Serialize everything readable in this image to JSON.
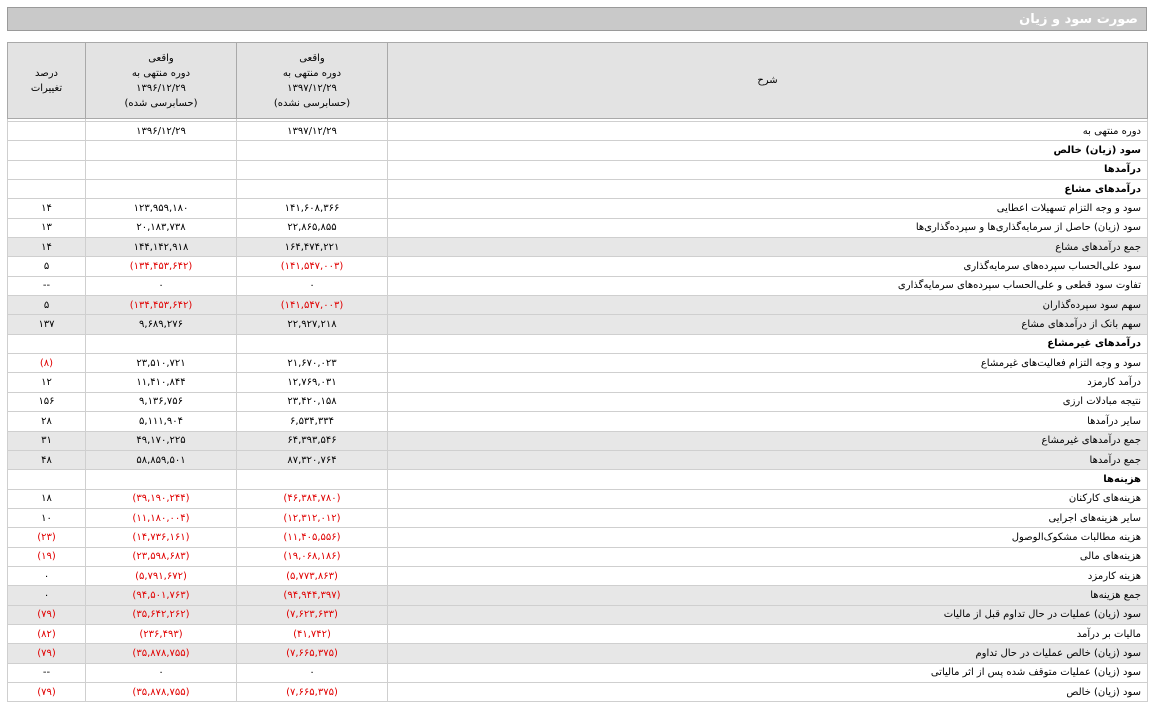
{
  "title": "صورت سود و زیان",
  "header": {
    "description": "شرح",
    "current": [
      "واقعی",
      "دوره منتهی به",
      "۱۳۹۷/۱۲/۲۹",
      "(حسابرسی نشده)"
    ],
    "previous": [
      "واقعی",
      "دوره منتهی به",
      "۱۳۹۶/۱۲/۲۹",
      "(حسابرسی شده)"
    ],
    "change": [
      "درصد",
      "تغییرات"
    ]
  },
  "rows": [
    {
      "desc": "دوره منتهی به",
      "cur": "۱۳۹۷/۱۲/۲۹",
      "prev": "۱۳۹۶/۱۲/۲۹",
      "pct": "",
      "bold": false,
      "shade": false
    },
    {
      "desc": "سود (زیان) خالص",
      "cur": "",
      "prev": "",
      "pct": "",
      "bold": true,
      "shade": false
    },
    {
      "desc": "درآمدها",
      "cur": "",
      "prev": "",
      "pct": "",
      "bold": true,
      "shade": false
    },
    {
      "desc": "درآمدهای مشاع",
      "cur": "",
      "prev": "",
      "pct": "",
      "bold": true,
      "shade": false
    },
    {
      "desc": "سود و وجه التزام تسهیلات اعطایی",
      "cur": "۱۴۱,۶۰۸,۳۶۶",
      "prev": "۱۲۳,۹۵۹,۱۸۰",
      "pct": "۱۴",
      "bold": false,
      "shade": false
    },
    {
      "desc": "سود (زیان) حاصل از سرمایه‌گذاری‌ها و سپرده‌گذاری‌ها",
      "cur": "۲۲,۸۶۵,۸۵۵",
      "prev": "۲۰,۱۸۳,۷۳۸",
      "pct": "۱۳",
      "bold": false,
      "shade": false
    },
    {
      "desc": "جمع درآمدهای مشاع",
      "cur": "۱۶۴,۴۷۴,۲۲۱",
      "prev": "۱۴۴,۱۴۲,۹۱۸",
      "pct": "۱۴",
      "bold": false,
      "shade": true
    },
    {
      "desc": "سود علی‌الحساب سپرده‌های سرمایه‌گذاری",
      "cur": "(۱۴۱,۵۴۷,۰۰۳)",
      "prev": "(۱۳۴,۴۵۳,۶۴۲)",
      "pct": "۵",
      "bold": false,
      "shade": false
    },
    {
      "desc": "تفاوت سود قطعی و علی‌الحساب سپرده‌های سرمایه‌گذاری",
      "cur": "۰",
      "prev": "۰",
      "pct": "--",
      "bold": false,
      "shade": false
    },
    {
      "desc": "سهم سود سپرده‌گذاران",
      "cur": "(۱۴۱,۵۴۷,۰۰۳)",
      "prev": "(۱۳۴,۴۵۳,۶۴۲)",
      "pct": "۵",
      "bold": false,
      "shade": true
    },
    {
      "desc": "سهم بانک از درآمدهای مشاع",
      "cur": "۲۲,۹۲۷,۲۱۸",
      "prev": "۹,۶۸۹,۲۷۶",
      "pct": "۱۳۷",
      "bold": false,
      "shade": true
    },
    {
      "desc": "درآمدهای غیرمشاع",
      "cur": "",
      "prev": "",
      "pct": "",
      "bold": true,
      "shade": false
    },
    {
      "desc": "سود و وجه التزام فعالیت‌های غیرمشاع",
      "cur": "۲۱,۶۷۰,۰۲۳",
      "prev": "۲۳,۵۱۰,۷۲۱",
      "pct": "(۸)",
      "bold": false,
      "shade": false
    },
    {
      "desc": "درآمد کارمزد",
      "cur": "۱۲,۷۶۹,۰۳۱",
      "prev": "۱۱,۴۱۰,۸۴۴",
      "pct": "۱۲",
      "bold": false,
      "shade": false
    },
    {
      "desc": "نتیجه مبادلات ارزی",
      "cur": "۲۳,۴۲۰,۱۵۸",
      "prev": "۹,۱۳۶,۷۵۶",
      "pct": "۱۵۶",
      "bold": false,
      "shade": false
    },
    {
      "desc": "سایر درآمدها",
      "cur": "۶,۵۳۴,۳۳۴",
      "prev": "۵,۱۱۱,۹۰۴",
      "pct": "۲۸",
      "bold": false,
      "shade": false
    },
    {
      "desc": "جمع درآمدهای غیرمشاع",
      "cur": "۶۴,۳۹۳,۵۴۶",
      "prev": "۴۹,۱۷۰,۲۲۵",
      "pct": "۳۱",
      "bold": false,
      "shade": true
    },
    {
      "desc": "جمع درآمدها",
      "cur": "۸۷,۳۲۰,۷۶۴",
      "prev": "۵۸,۸۵۹,۵۰۱",
      "pct": "۴۸",
      "bold": false,
      "shade": true
    },
    {
      "desc": "هزینه‌ها",
      "cur": "",
      "prev": "",
      "pct": "",
      "bold": true,
      "shade": false
    },
    {
      "desc": "هزینه‌های کارکنان",
      "cur": "(۴۶,۳۸۴,۷۸۰)",
      "prev": "(۳۹,۱۹۰,۲۴۴)",
      "pct": "۱۸",
      "bold": false,
      "shade": false
    },
    {
      "desc": "سایر هزینه‌های اجرایی",
      "cur": "(۱۲,۳۱۲,۰۱۲)",
      "prev": "(۱۱,۱۸۰,۰۰۴)",
      "pct": "۱۰",
      "bold": false,
      "shade": false
    },
    {
      "desc": "هزینه مطالبات مشکوک‌الوصول",
      "cur": "(۱۱,۴۰۵,۵۵۶)",
      "prev": "(۱۴,۷۳۶,۱۶۱)",
      "pct": "(۲۳)",
      "bold": false,
      "shade": false
    },
    {
      "desc": "هزینه‌های مالی",
      "cur": "(۱۹,۰۶۸,۱۸۶)",
      "prev": "(۲۳,۵۹۸,۶۸۳)",
      "pct": "(۱۹)",
      "bold": false,
      "shade": false
    },
    {
      "desc": "هزینه کارمزد",
      "cur": "(۵,۷۷۳,۸۶۳)",
      "prev": "(۵,۷۹۱,۶۷۲)",
      "pct": "۰",
      "bold": false,
      "shade": false
    },
    {
      "desc": "جمع هزینه‌ها",
      "cur": "(۹۴,۹۴۴,۳۹۷)",
      "prev": "(۹۴,۵۰۱,۷۶۳)",
      "pct": "۰",
      "bold": false,
      "shade": true
    },
    {
      "desc": "سود (زیان) عملیات در حال تداوم قبل از مالیات",
      "cur": "(۷,۶۲۳,۶۳۳)",
      "prev": "(۳۵,۶۴۲,۲۶۲)",
      "pct": "(۷۹)",
      "bold": false,
      "shade": true
    },
    {
      "desc": "مالیات بر درآمد",
      "cur": "(۴۱,۷۴۲)",
      "prev": "(۲۳۶,۴۹۳)",
      "pct": "(۸۲)",
      "bold": false,
      "shade": false
    },
    {
      "desc": "سود (زیان) خالص عملیات در حال تداوم",
      "cur": "(۷,۶۶۵,۳۷۵)",
      "prev": "(۳۵,۸۷۸,۷۵۵)",
      "pct": "(۷۹)",
      "bold": false,
      "shade": true
    },
    {
      "desc": "سود (زیان) عملیات متوقف شده پس از اثر مالیاتی",
      "cur": "۰",
      "prev": "۰",
      "pct": "--",
      "bold": false,
      "shade": false
    },
    {
      "desc": "سود (زیان) خالص",
      "cur": "(۷,۶۶۵,۳۷۵)",
      "prev": "(۳۵,۸۷۸,۷۵۵)",
      "pct": "(۷۹)",
      "bold": false,
      "shade": false
    }
  ]
}
